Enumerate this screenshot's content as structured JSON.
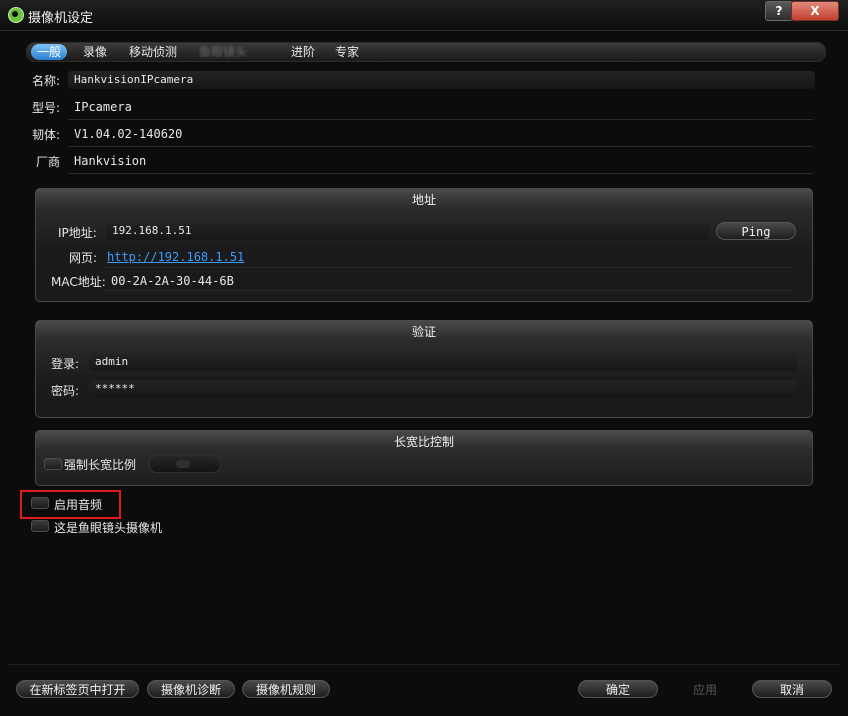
{
  "window": {
    "title": "摄像机设定",
    "help_label": "?",
    "close_label": "X"
  },
  "tabs": [
    {
      "label": "一般",
      "active": true
    },
    {
      "label": "录像"
    },
    {
      "label": "移动侦测"
    },
    {
      "label": "鱼眼镜头"
    },
    {
      "label": "进阶"
    },
    {
      "label": "专家"
    }
  ],
  "info": {
    "name_label": "名称:",
    "name_value": "HankvisionIPcamera",
    "model_label": "型号:",
    "model_value": "IPcamera",
    "firmware_label": "韧体:",
    "firmware_value": "V1.04.02-140620",
    "vendor_label": "厂商",
    "vendor_value": "Hankvision"
  },
  "address_panel": {
    "title": "地址",
    "ip_label": "IP地址:",
    "ip_value": "192.168.1.51",
    "ping_label": "Ping",
    "web_label": "网页:",
    "web_value": "http://192.168.1.51",
    "mac_label": "MAC地址:",
    "mac_value": "00-2A-2A-30-44-6B"
  },
  "auth_panel": {
    "title": "验证",
    "login_label": "登录:",
    "login_value": "admin",
    "password_label": "密码:",
    "password_value": "******"
  },
  "aspect_panel": {
    "title": "长宽比控制",
    "force_label": "强制长宽比例"
  },
  "options": {
    "audio_label": "启用音频",
    "fisheye_label": "这是鱼眼镜头摄像机"
  },
  "footer": {
    "open_tab_label": "在新标签页中打开",
    "diagnose_label": "摄像机诊断",
    "rules_label": "摄像机规则",
    "ok_label": "确定",
    "apply_label": "应用",
    "cancel_label": "取消"
  },
  "colors": {
    "tab_active": "#2a7fd3",
    "link": "#3d9bff",
    "highlight": "#e01b1b"
  }
}
